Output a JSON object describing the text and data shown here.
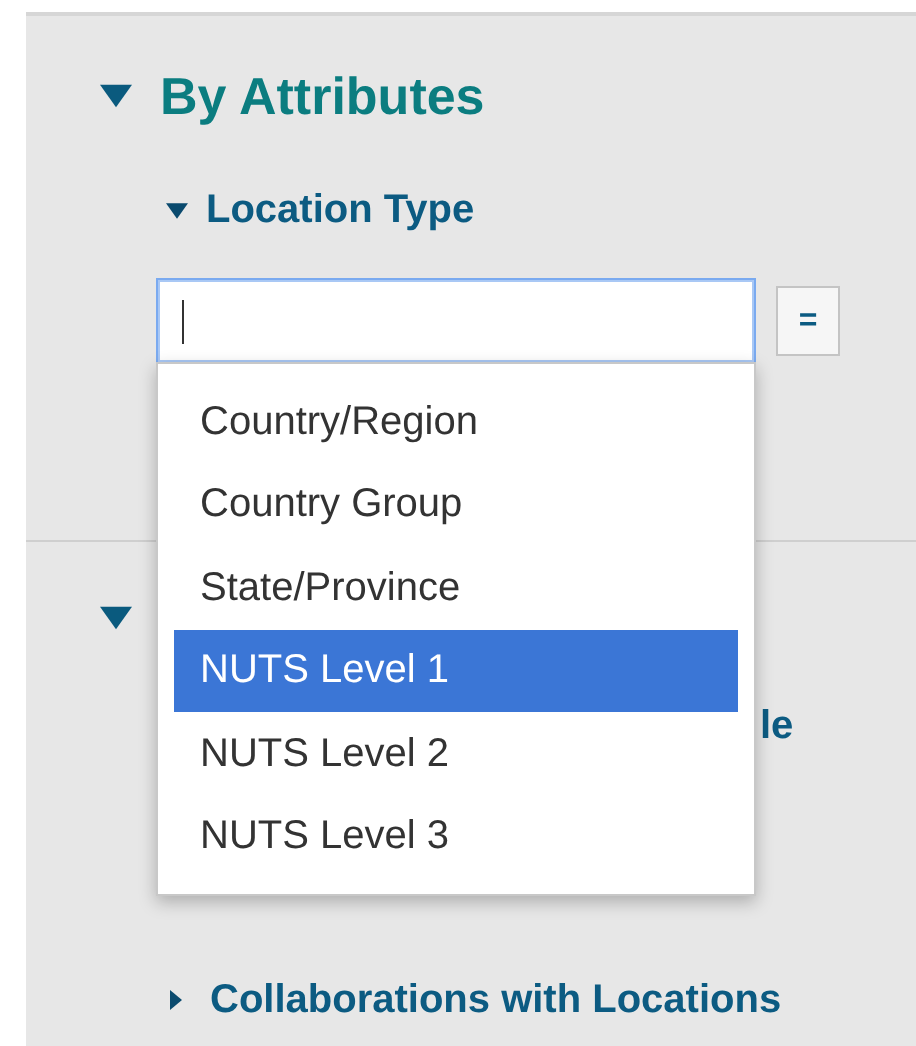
{
  "section": {
    "title": "By Attributes",
    "expanded": true
  },
  "filter": {
    "title": "Location Type",
    "expanded": true,
    "focused": true,
    "operator_button": "="
  },
  "dropdown": {
    "options": [
      {
        "label": "Country/Region",
        "selected": false
      },
      {
        "label": "Country Group",
        "selected": false
      },
      {
        "label": "State/Province",
        "selected": false
      },
      {
        "label": "NUTS Level 1",
        "selected": true
      },
      {
        "label": "NUTS Level 2",
        "selected": false
      },
      {
        "label": "NUTS Level 3",
        "selected": false
      }
    ]
  },
  "section_2": {
    "expanded": true,
    "items": [
      {
        "text": "le",
        "kind": "fragment"
      },
      {
        "text": "Collaborations with Locations",
        "kind": "toggle",
        "expanded": false
      }
    ]
  }
}
